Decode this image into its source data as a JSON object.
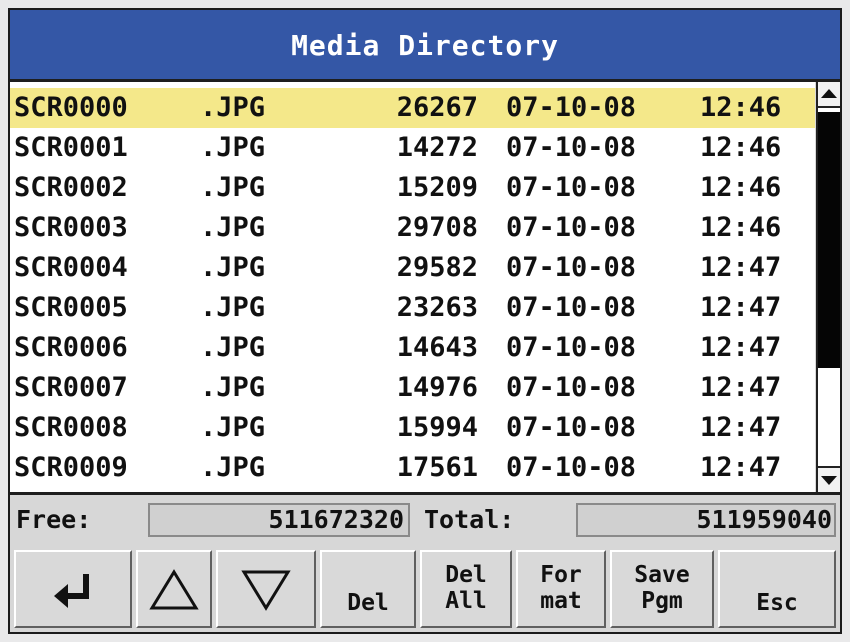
{
  "title": "Media Directory",
  "files": [
    {
      "name": "SCR0000",
      "ext": ".JPG",
      "size": "26267",
      "date": "07-10-08",
      "time": "12:46",
      "selected": true
    },
    {
      "name": "SCR0001",
      "ext": ".JPG",
      "size": "14272",
      "date": "07-10-08",
      "time": "12:46",
      "selected": false
    },
    {
      "name": "SCR0002",
      "ext": ".JPG",
      "size": "15209",
      "date": "07-10-08",
      "time": "12:46",
      "selected": false
    },
    {
      "name": "SCR0003",
      "ext": ".JPG",
      "size": "29708",
      "date": "07-10-08",
      "time": "12:46",
      "selected": false
    },
    {
      "name": "SCR0004",
      "ext": ".JPG",
      "size": "29582",
      "date": "07-10-08",
      "time": "12:47",
      "selected": false
    },
    {
      "name": "SCR0005",
      "ext": ".JPG",
      "size": "23263",
      "date": "07-10-08",
      "time": "12:47",
      "selected": false
    },
    {
      "name": "SCR0006",
      "ext": ".JPG",
      "size": "14643",
      "date": "07-10-08",
      "time": "12:47",
      "selected": false
    },
    {
      "name": "SCR0007",
      "ext": ".JPG",
      "size": "14976",
      "date": "07-10-08",
      "time": "12:47",
      "selected": false
    },
    {
      "name": "SCR0008",
      "ext": ".JPG",
      "size": "15994",
      "date": "07-10-08",
      "time": "12:47",
      "selected": false
    },
    {
      "name": "SCR0009",
      "ext": ".JPG",
      "size": "17561",
      "date": "07-10-08",
      "time": "12:47",
      "selected": false
    }
  ],
  "status": {
    "free_label": "Free:",
    "free_value": "511672320",
    "total_label": "Total:",
    "total_value": "511959040"
  },
  "buttons": {
    "enter_icon": "enter-arrow-icon",
    "up_icon": "triangle-up-icon",
    "down_icon": "triangle-down-icon",
    "del": "Del",
    "del_all_1": "Del",
    "del_all_2": "All",
    "format_1": "For",
    "format_2": "mat",
    "save_pgm_1": "Save",
    "save_pgm_2": "Pgm",
    "esc": "Esc"
  },
  "colors": {
    "title_bar": "#3457a6",
    "selected_row": "#f4e88a"
  }
}
